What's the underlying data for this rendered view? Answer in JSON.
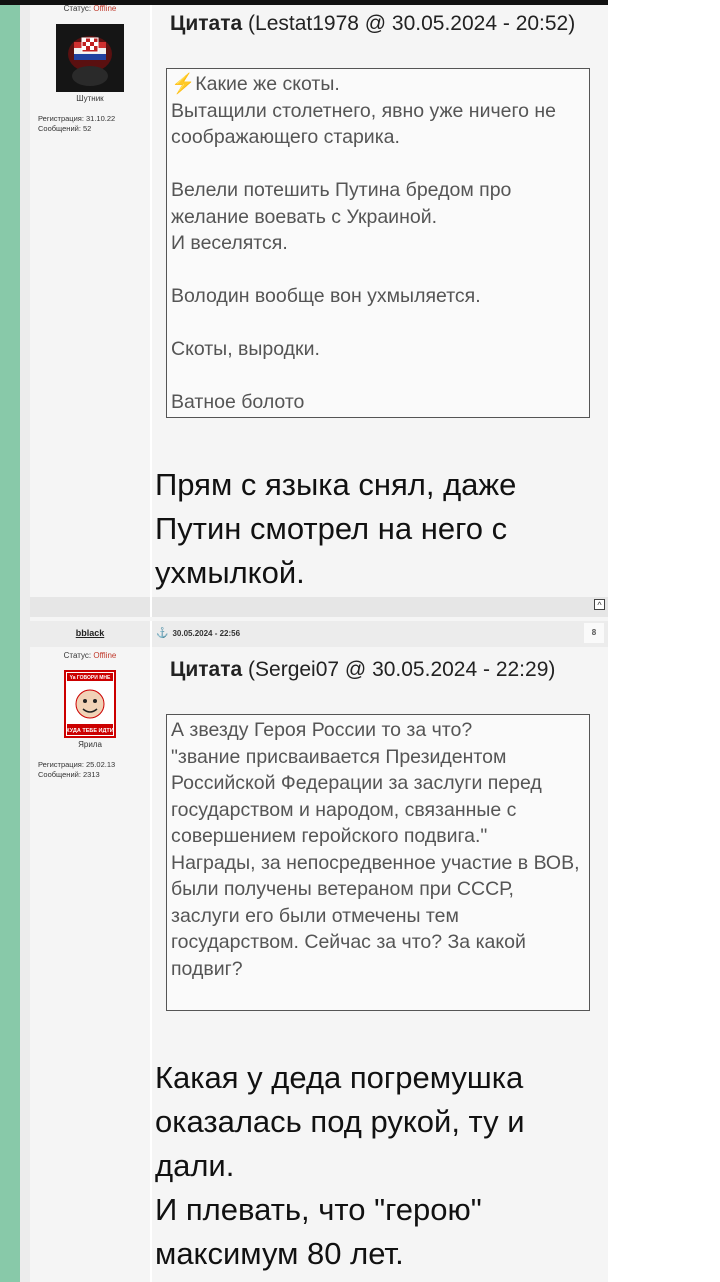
{
  "post1": {
    "user": {
      "status_label": "Статус: ",
      "status_value": "Offline",
      "rank": "Шутник",
      "registration": "Регистрация: 31.10.22",
      "messages": "Сообщений: 52"
    },
    "quote": {
      "label": "Цитата",
      "source": " (Lestat1978 @ 30.05.2024 - 20:52)",
      "lines": [
        "⚡Какие же скоты.",
        "Вытащили столетнего, явно уже ничего не соображающего старика.",
        "",
        "Велели потешить Путина бредом про желание воевать с Украиной.",
        "И веселятся.",
        "",
        "Володин вообще вон ухмыляется.",
        "",
        "Скоты, выродки.",
        "",
        "Ватное болото"
      ]
    },
    "text": [
      "Прям с языка снял, даже Путин смотрел на него с ухмылкой."
    ],
    "up_button": "^"
  },
  "post2": {
    "username": "bblack",
    "datetime": "30.05.2024 - 22:56",
    "number": "8",
    "user": {
      "status_label": "Статус: ",
      "status_value": "Offline",
      "rank": "Ярила",
      "registration": "Регистрация: 25.02.13",
      "messages": "Сообщений: 2313",
      "avatar_text_top": "Ya ГОВОРИ МНЕ",
      "avatar_text_bottom": "КУДА ТЕБЕ ИДТИ"
    },
    "quote": {
      "label": "Цитата",
      "source": " (Sergei07 @ 30.05.2024 - 22:29)",
      "lines": [
        "А звезду Героя России то за что?",
        "\"звание присваивается Президентом Российской Федерации за заслуги перед государством и народом, связанные с совершением геройского подвига.\"",
        "Награды, за непосредвенное участие в ВОВ, были получены ветераном при СССР, заслуги его были отмечены тем государством. Сейчас за что? За какой подвиг?"
      ]
    },
    "text": [
      "Какая у деда погремушка оказалась под рукой, ту и дали.",
      "И плевать, что \"герою\" максимум 80 лет."
    ]
  },
  "colors": {
    "accent": "#88c9a9",
    "status_offline": "#c0392b",
    "anchor": "#2a73c4"
  },
  "icons": {
    "lightning": "lightning-icon",
    "anchor": "anchor-icon",
    "up_arrow": "scroll-top-icon"
  }
}
